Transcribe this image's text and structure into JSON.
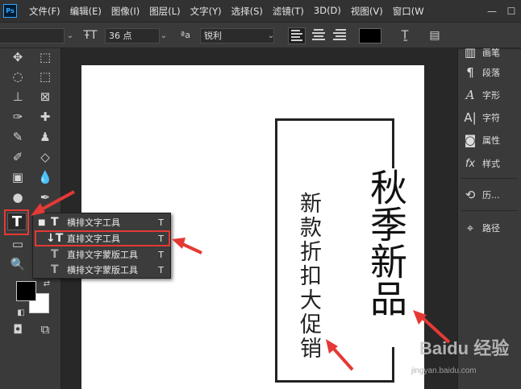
{
  "app": {
    "logo": "Ps",
    "menu": [
      "文件(F)",
      "编辑(E)",
      "图像(I)",
      "图层(L)",
      "文字(Y)",
      "选择(S)",
      "滤镜(T)",
      "3D(D)",
      "视图(V)",
      "窗口(W"
    ],
    "window_controls": [
      "—",
      "☐"
    ]
  },
  "options_bar": {
    "font_size": "36 点",
    "aa_label": "ªa",
    "antialias": "锐利"
  },
  "document": {
    "title_text": "秋季新品",
    "sub_text": "新款折扣大促销"
  },
  "flyout": {
    "items": [
      {
        "label": "横排文字工具",
        "key": "T",
        "icon": "T",
        "active": true
      },
      {
        "label": "直排文字工具",
        "key": "T",
        "icon": "↓T",
        "active": false
      },
      {
        "label": "直排文字蒙版工具",
        "key": "T",
        "icon": "T",
        "active": false
      },
      {
        "label": "横排文字蒙版工具",
        "key": "T",
        "icon": "T",
        "active": false
      }
    ]
  },
  "panels": {
    "items": [
      {
        "label": "画笔",
        "icon": "brush-settings-icon"
      },
      {
        "label": "段落",
        "icon": "paragraph-icon"
      },
      {
        "label": "字形",
        "icon": "glyphs-icon"
      },
      {
        "label": "字符",
        "icon": "character-icon"
      },
      {
        "label": "属性",
        "icon": "properties-icon"
      },
      {
        "label": "样式",
        "icon": "styles-icon"
      },
      {
        "label": "历...",
        "icon": "history-icon"
      },
      {
        "label": "路径",
        "icon": "paths-icon"
      }
    ]
  },
  "watermark": {
    "main": "Baidu 经验",
    "sub": "jingyan.baidu.com"
  },
  "colors": {
    "highlight": "#e53935",
    "foreground": "#000000",
    "background": "#ffffff"
  }
}
